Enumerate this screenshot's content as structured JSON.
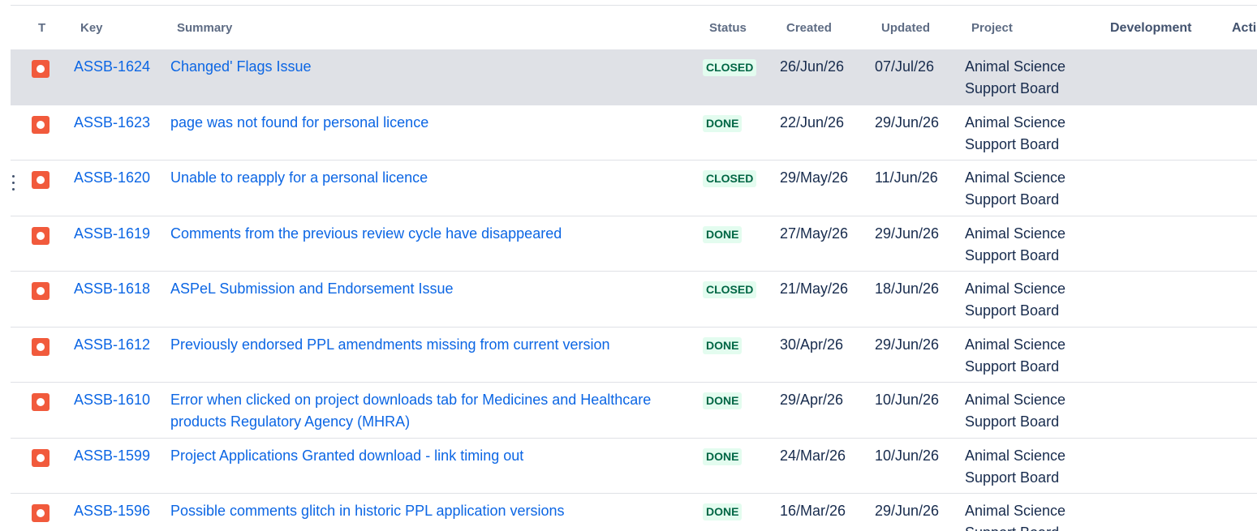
{
  "table": {
    "columns": {
      "type": "T",
      "key": "Key",
      "summary": "Summary",
      "status": "Status",
      "created": "Created",
      "updated": "Updated",
      "project": "Project",
      "development": "Development",
      "actions": "Acti"
    },
    "type_icon": "issue-type-icon",
    "drag_handle_icon": "drag-handle-icon",
    "rows": [
      {
        "key": "ASSB-1624",
        "summary": "Changed' Flags Issue",
        "status": "CLOSED",
        "created": "26/Jun/26",
        "updated": "07/Jul/26",
        "project": "Animal Science Support Board",
        "selected": true
      },
      {
        "key": "ASSB-1623",
        "summary": "page was not found for personal licence",
        "status": "DONE",
        "created": "22/Jun/26",
        "updated": "29/Jun/26",
        "project": "Animal Science Support Board"
      },
      {
        "key": "ASSB-1620",
        "summary": "Unable to reapply for a personal licence",
        "status": "CLOSED",
        "created": "29/May/26",
        "updated": "11/Jun/26",
        "project": "Animal Science Support Board",
        "drag_handle_visible": true
      },
      {
        "key": "ASSB-1619",
        "summary": "Comments from the previous review cycle have disappeared",
        "status": "DONE",
        "created": "27/May/26",
        "updated": "29/Jun/26",
        "project": "Animal Science Support Board"
      },
      {
        "key": "ASSB-1618",
        "summary": "ASPeL Submission and Endorsement Issue",
        "status": "CLOSED",
        "created": "21/May/26",
        "updated": "18/Jun/26",
        "project": "Animal Science Support Board"
      },
      {
        "key": "ASSB-1612",
        "summary": "Previously endorsed PPL amendments missing from current version",
        "status": "DONE",
        "created": "30/Apr/26",
        "updated": "29/Jun/26",
        "project": "Animal Science Support Board"
      },
      {
        "key": "ASSB-1610",
        "summary": "Error when clicked on project downloads tab for Medicines and Healthcare products Regulatory Agency (MHRA)",
        "status": "DONE",
        "created": "29/Apr/26",
        "updated": "10/Jun/26",
        "project": "Animal Science Support Board"
      },
      {
        "key": "ASSB-1599",
        "summary": "Project Applications Granted download - link timing out",
        "status": "DONE",
        "created": "24/Mar/26",
        "updated": "10/Jun/26",
        "project": "Animal Science Support Board"
      },
      {
        "key": "ASSB-1596",
        "summary": "Possible comments glitch in historic PPL application versions",
        "status": "DONE",
        "created": "16/Mar/26",
        "updated": "29/Jun/26",
        "project": "Animal Science Support Board"
      }
    ]
  },
  "colors": {
    "link": "#0c66e4",
    "text": "#172b4d",
    "header_text": "#5e6c84",
    "header_text_dark": "#42526e",
    "divider": "#dfe1e6",
    "selected_row_bg": "#dfe1e6",
    "status_done_bg": "#e3fcef",
    "status_done_text": "#006644",
    "issue_type_icon": "#f15a3c"
  }
}
